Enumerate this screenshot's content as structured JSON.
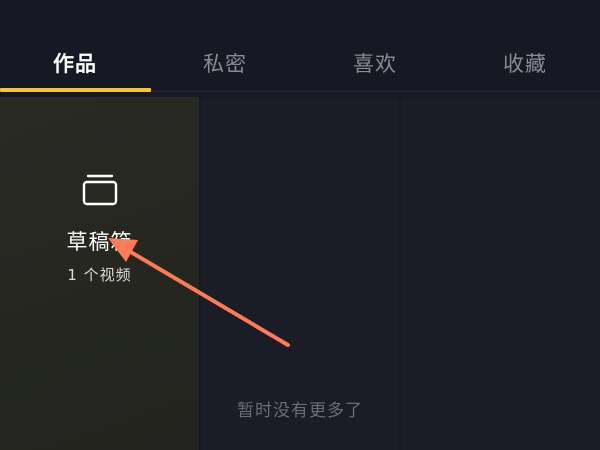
{
  "tabs": [
    {
      "label": "作品",
      "active": true
    },
    {
      "label": "私密",
      "active": false
    },
    {
      "label": "喜欢",
      "active": false
    },
    {
      "label": "收藏",
      "active": false
    }
  ],
  "drafts": {
    "icon": "drafts-box-icon",
    "title": "草稿箱",
    "count": "1 个视频"
  },
  "footer": {
    "no_more": "暂时没有更多了"
  },
  "colors": {
    "background": "#161823",
    "accent": "#f5c82a",
    "annotation_arrow": "#ff7a58"
  }
}
